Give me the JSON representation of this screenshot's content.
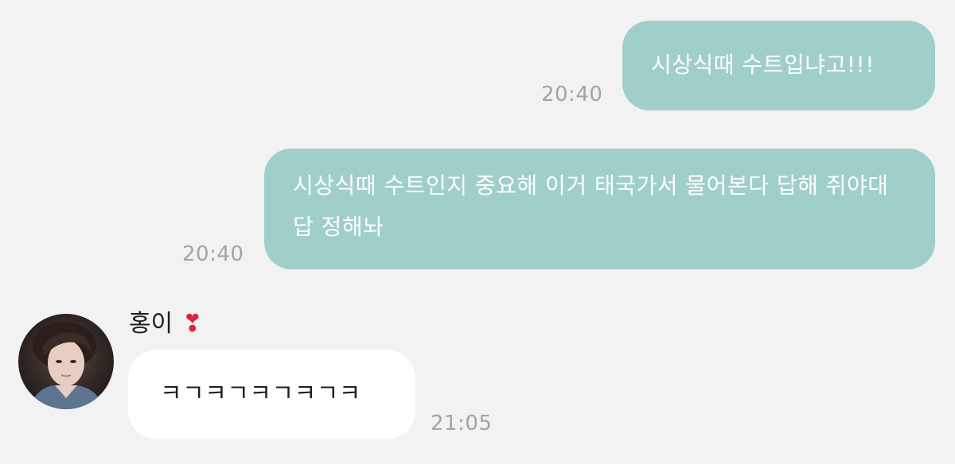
{
  "messages": [
    {
      "sender": "me",
      "text": "시상식때 수트입냐고!!!",
      "time": "20:40"
    },
    {
      "sender": "me",
      "text": "시상식때 수트인지 중요해 이거 태국가서 물어본다 답해 쥐야대 답 정해놔",
      "time": "20:40"
    },
    {
      "sender": "other",
      "text": "ㅋㄱㅋㄱㅋㄱㅋㄱㅋ",
      "time": "21:05"
    }
  ],
  "contact": {
    "name": "홍이",
    "badge_icon": "exclamation-heart-icon"
  },
  "colors": {
    "background": "#f2f2f2",
    "my_bubble": "#a0cfca",
    "their_bubble": "#ffffff",
    "timestamp": "#a4a4a4"
  }
}
